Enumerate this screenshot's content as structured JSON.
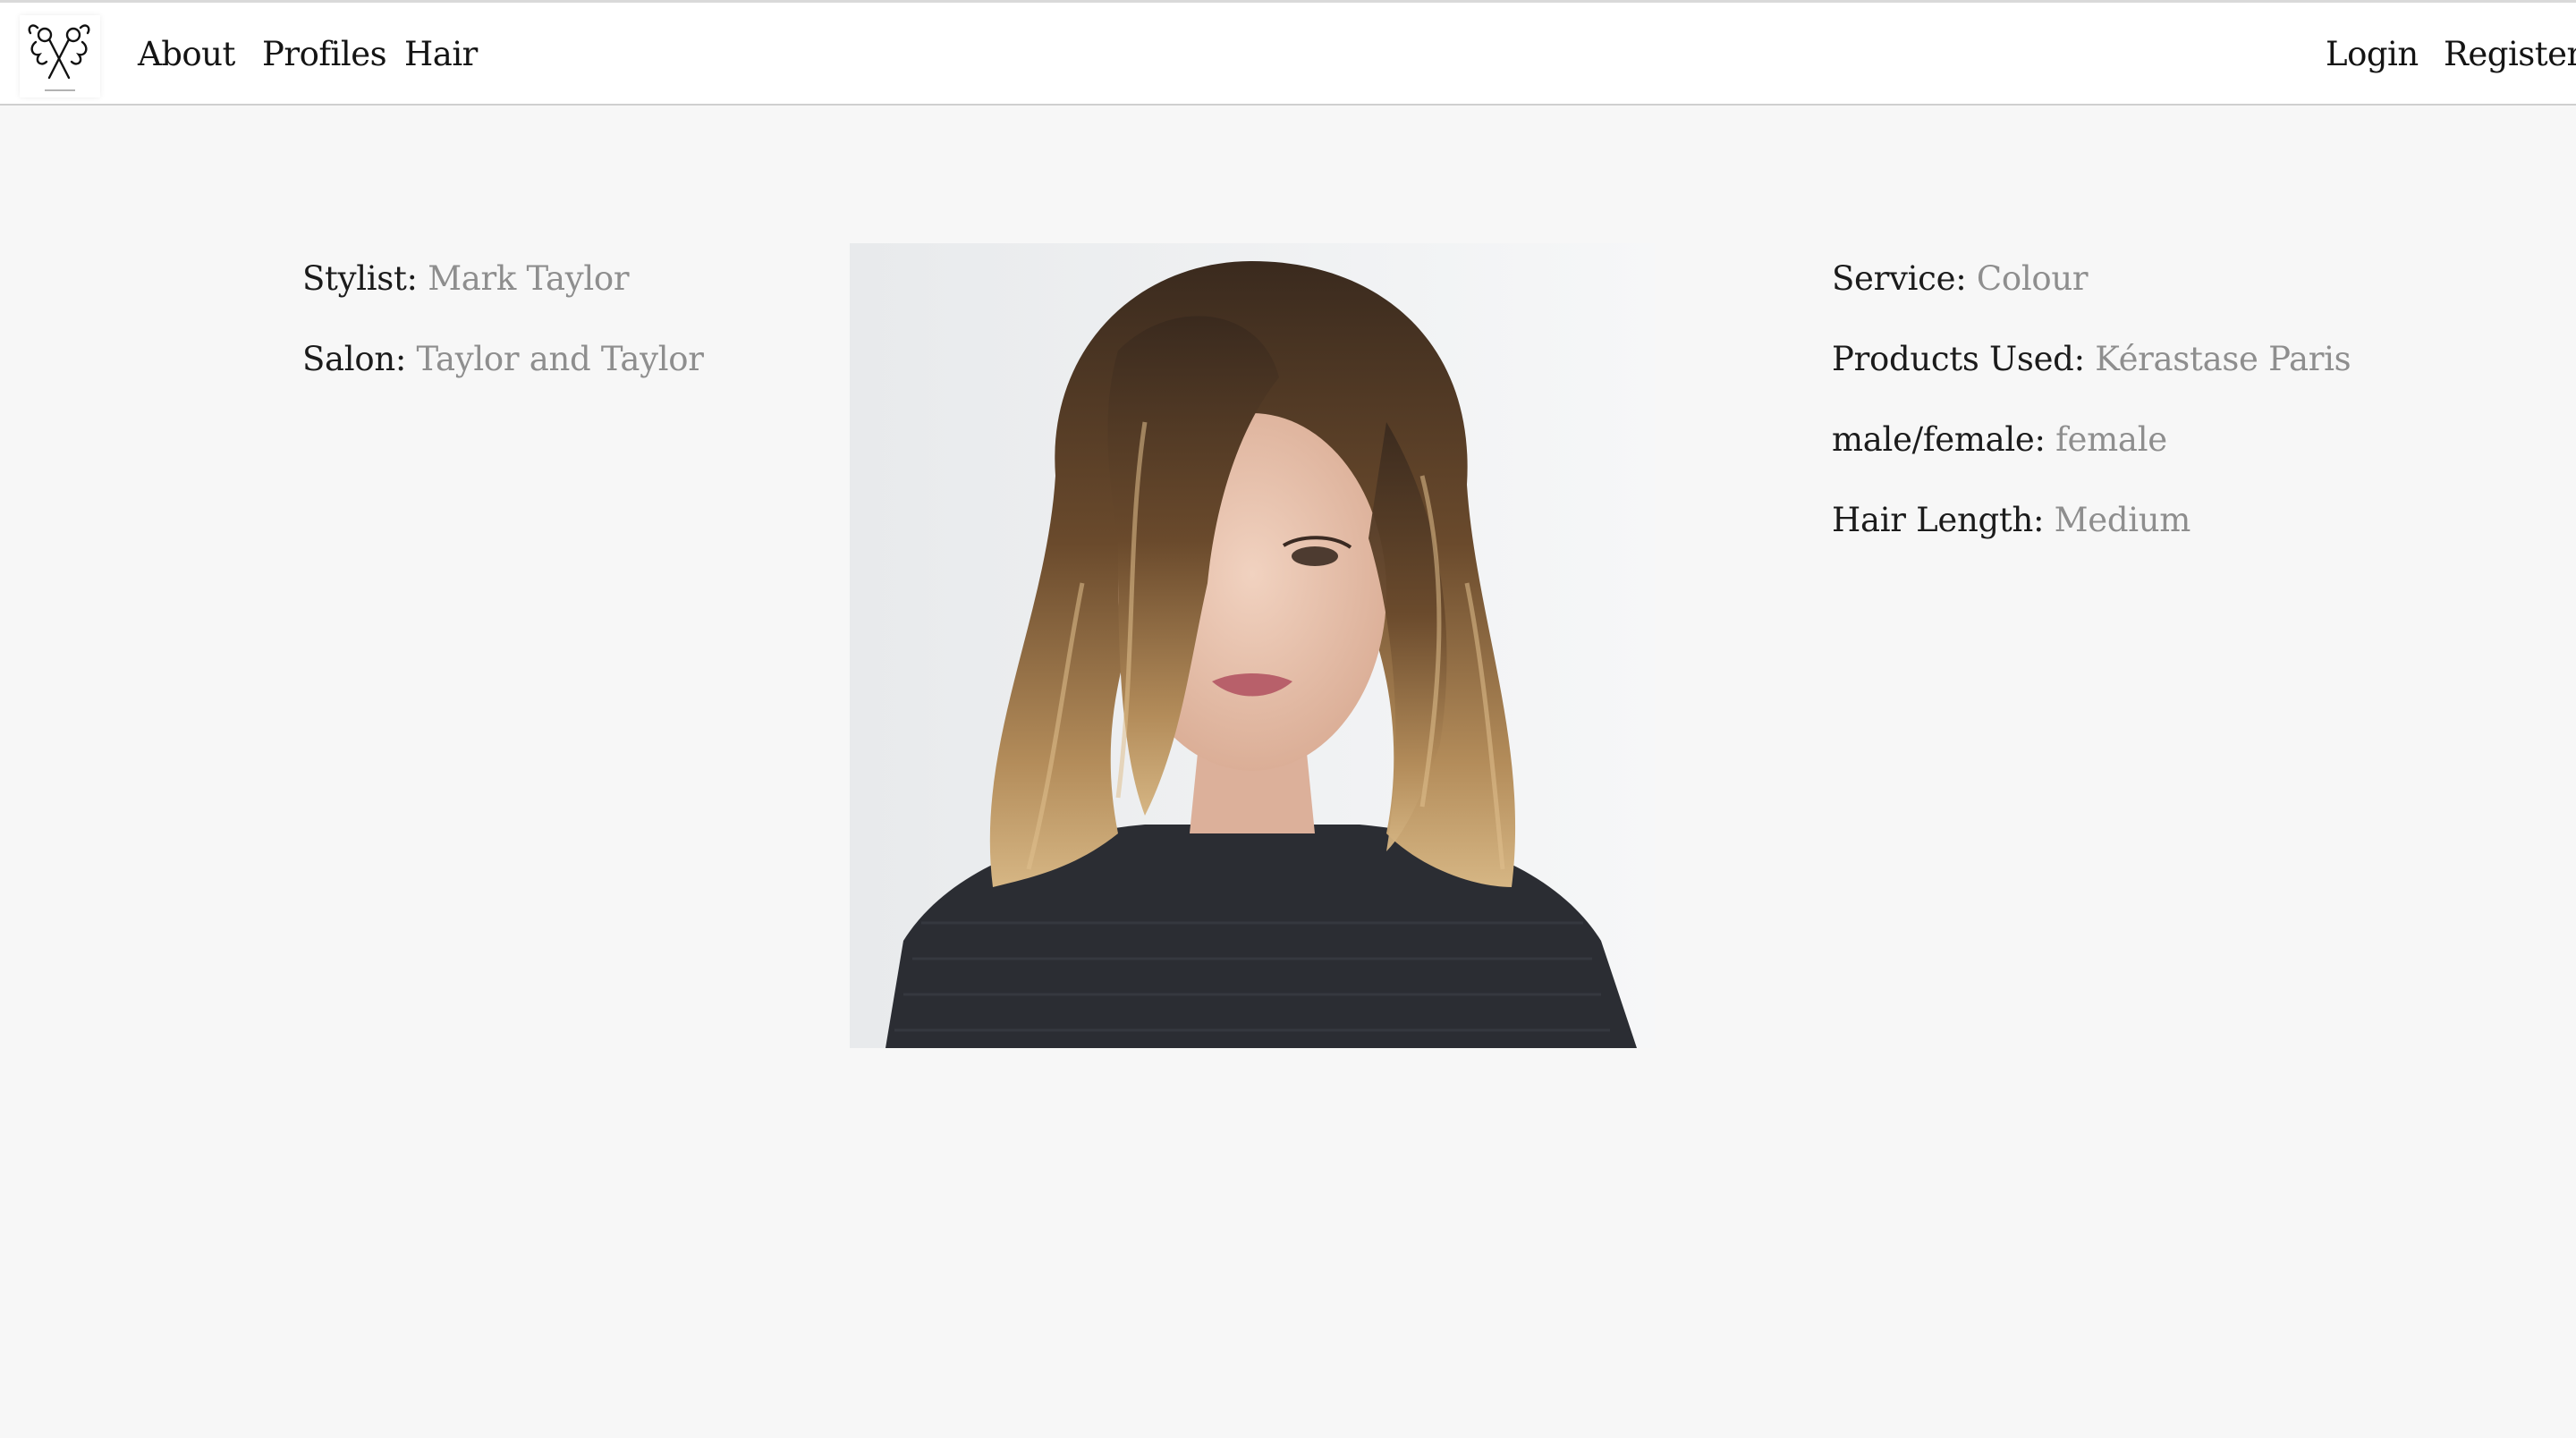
{
  "nav": {
    "logo_icon": "scissors-hair-logo-icon",
    "links": {
      "about": "About",
      "profiles": "Profiles",
      "hair": "Hair"
    },
    "auth": {
      "login": "Login",
      "register": "Register"
    }
  },
  "details": {
    "stylist": {
      "label": "Stylist",
      "value": "Mark Taylor"
    },
    "salon": {
      "label": "Salon",
      "value": "Taylor and Taylor"
    },
    "service": {
      "label": "Service",
      "value": "Colour"
    },
    "products": {
      "label": "Products Used",
      "value": "Kérastase Paris"
    },
    "gender": {
      "label": "male/female",
      "value": "female"
    },
    "hair_length": {
      "label": "Hair Length",
      "value": "Medium"
    }
  },
  "colors": {
    "background": "#f7f7f7",
    "label": "#1b1b1b",
    "value": "#8e8e8e"
  }
}
